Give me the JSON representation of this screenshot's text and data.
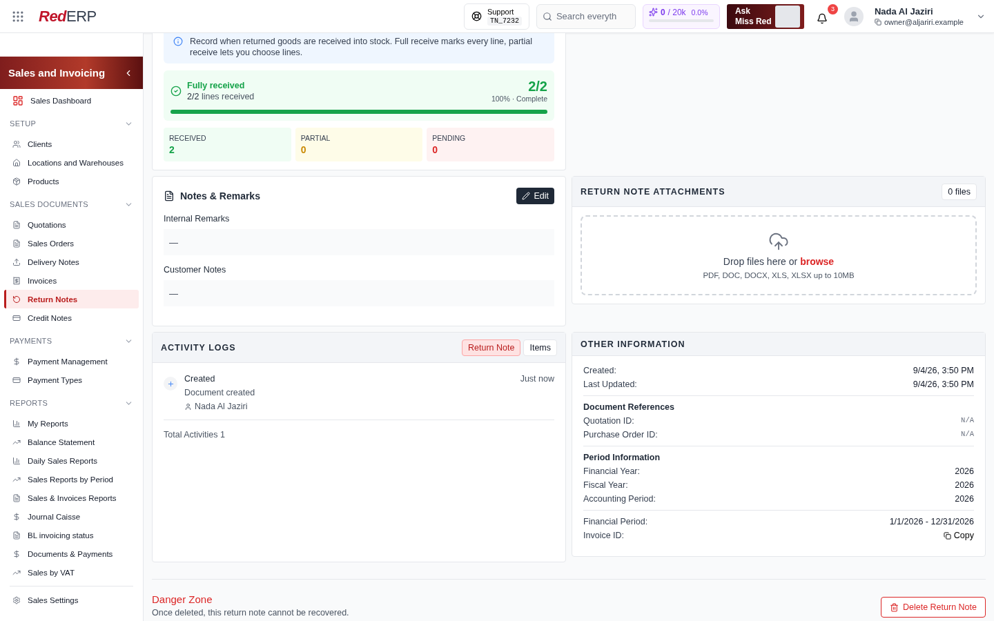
{
  "header": {
    "logo": {
      "lead": "Red",
      "tail": "ERP"
    },
    "support": {
      "label": "Support",
      "code": "TN_7232"
    },
    "search": {
      "placeholder": "Search everyth"
    },
    "usage": {
      "used": "0",
      "limit": "/ 20k",
      "percent": "0.0%",
      "level": 0
    },
    "ask": {
      "line_1": "Ask",
      "line_2": "Miss Red"
    },
    "notifications": {
      "count": "3"
    },
    "user": {
      "name": "Nada Al Jaziri",
      "email": "owner@aljariri.example"
    }
  },
  "sidebar": {
    "title": "Sales and Invoicing",
    "dashboard": {
      "label": "Sales Dashboard",
      "selected": false
    },
    "sections": [
      {
        "title": "SETUP",
        "expanded": true,
        "items": [
          {
            "label": "Clients",
            "selected": false
          },
          {
            "label": "Locations and Warehouses",
            "selected": false
          },
          {
            "label": "Products",
            "selected": false
          }
        ]
      },
      {
        "title": "SALES DOCUMENTS",
        "expanded": true,
        "items": [
          {
            "label": "Quotations",
            "selected": false
          },
          {
            "label": "Sales Orders",
            "selected": false
          },
          {
            "label": "Delivery Notes",
            "selected": false
          },
          {
            "label": "Invoices",
            "selected": false
          },
          {
            "label": "Return Notes",
            "selected": true
          },
          {
            "label": "Credit Notes",
            "selected": false
          }
        ]
      },
      {
        "title": "PAYMENTS",
        "expanded": true,
        "items": [
          {
            "label": "Payment Management",
            "selected": false
          },
          {
            "label": "Payment Types",
            "selected": false
          }
        ]
      },
      {
        "title": "REPORTS",
        "expanded": true,
        "items": [
          {
            "label": "My Reports",
            "selected": false
          },
          {
            "label": "Balance Statement",
            "selected": false
          },
          {
            "label": "Daily Sales Reports",
            "selected": false
          },
          {
            "label": "Sales Reports by Period",
            "selected": false
          },
          {
            "label": "Sales & Invoices Reports",
            "selected": false
          },
          {
            "label": "Journal Caisse",
            "selected": false
          },
          {
            "label": "BL invoicing status",
            "selected": false
          },
          {
            "label": "Documents & Payments",
            "selected": false
          },
          {
            "label": "Sales by VAT",
            "selected": false
          }
        ]
      }
    ],
    "settings": {
      "label": "Sales Settings",
      "selected": false
    }
  },
  "receiving": {
    "info": "Record when returned goods are received into stock. Full receive marks every line, partial receive lets you choose lines.",
    "progress": {
      "title": "Fully received",
      "count": "2/2",
      "caption": "lines received",
      "ratio": "2/2",
      "status": "100% · Complete",
      "level": 1
    },
    "stats": [
      {
        "kind": "received",
        "label": "RECEIVED",
        "value": "2"
      },
      {
        "kind": "partial",
        "label": "PARTIAL",
        "value": "0"
      },
      {
        "kind": "pending",
        "label": "PENDING",
        "value": "0"
      }
    ]
  },
  "notes": {
    "title": "Notes & Remarks",
    "edit": "Edit",
    "fields": [
      {
        "label": "Internal Remarks",
        "value": "—"
      },
      {
        "label": "Customer Notes",
        "value": "—"
      }
    ]
  },
  "attachments": {
    "title": "RETURN NOTE ATTACHMENTS",
    "count": "0 files",
    "drop_text": "Drop files here or",
    "browse": "browse",
    "hint": "PDF, DOC, DOCX, XLS, XLSX up to 10MB"
  },
  "activity": {
    "title": "ACTIVITY LOGS",
    "tabs": [
      {
        "label": "Return Note",
        "selected": true
      },
      {
        "label": "Items",
        "selected": false
      }
    ],
    "entries": [
      {
        "title": "Created",
        "time": "Just now",
        "description": "Document created",
        "user": "Nada Al Jaziri"
      }
    ],
    "total": "Total Activities 1"
  },
  "other_info": {
    "title": "OTHER INFORMATION",
    "groups": [
      {
        "rows": [
          {
            "label": "Created:",
            "value": "9/4/26, 3:50 PM"
          },
          {
            "label": "Last Updated:",
            "value": "9/4/26, 3:50 PM"
          }
        ]
      },
      {
        "heading": "Document References",
        "rows": [
          {
            "label": "Quotation ID:",
            "value": "N/A",
            "kind": "mono"
          },
          {
            "label": "Purchase Order ID:",
            "value": "N/A",
            "kind": "mono"
          }
        ]
      },
      {
        "heading": "Period Information",
        "rows": [
          {
            "label": "Financial Year:",
            "value": "2026"
          },
          {
            "label": "Fiscal Year:",
            "value": "2026"
          },
          {
            "label": "Accounting Period:",
            "value": "2026"
          }
        ]
      },
      {
        "rows": [
          {
            "label": "Financial Period:",
            "value": "1/1/2026 - 12/31/2026"
          },
          {
            "label": "Invoice ID:",
            "value": "Copy",
            "kind": "copy"
          }
        ]
      }
    ]
  },
  "danger": {
    "title": "Danger Zone",
    "text": "Once deleted, this return note cannot be recovered.",
    "button": "Delete Return Note"
  }
}
